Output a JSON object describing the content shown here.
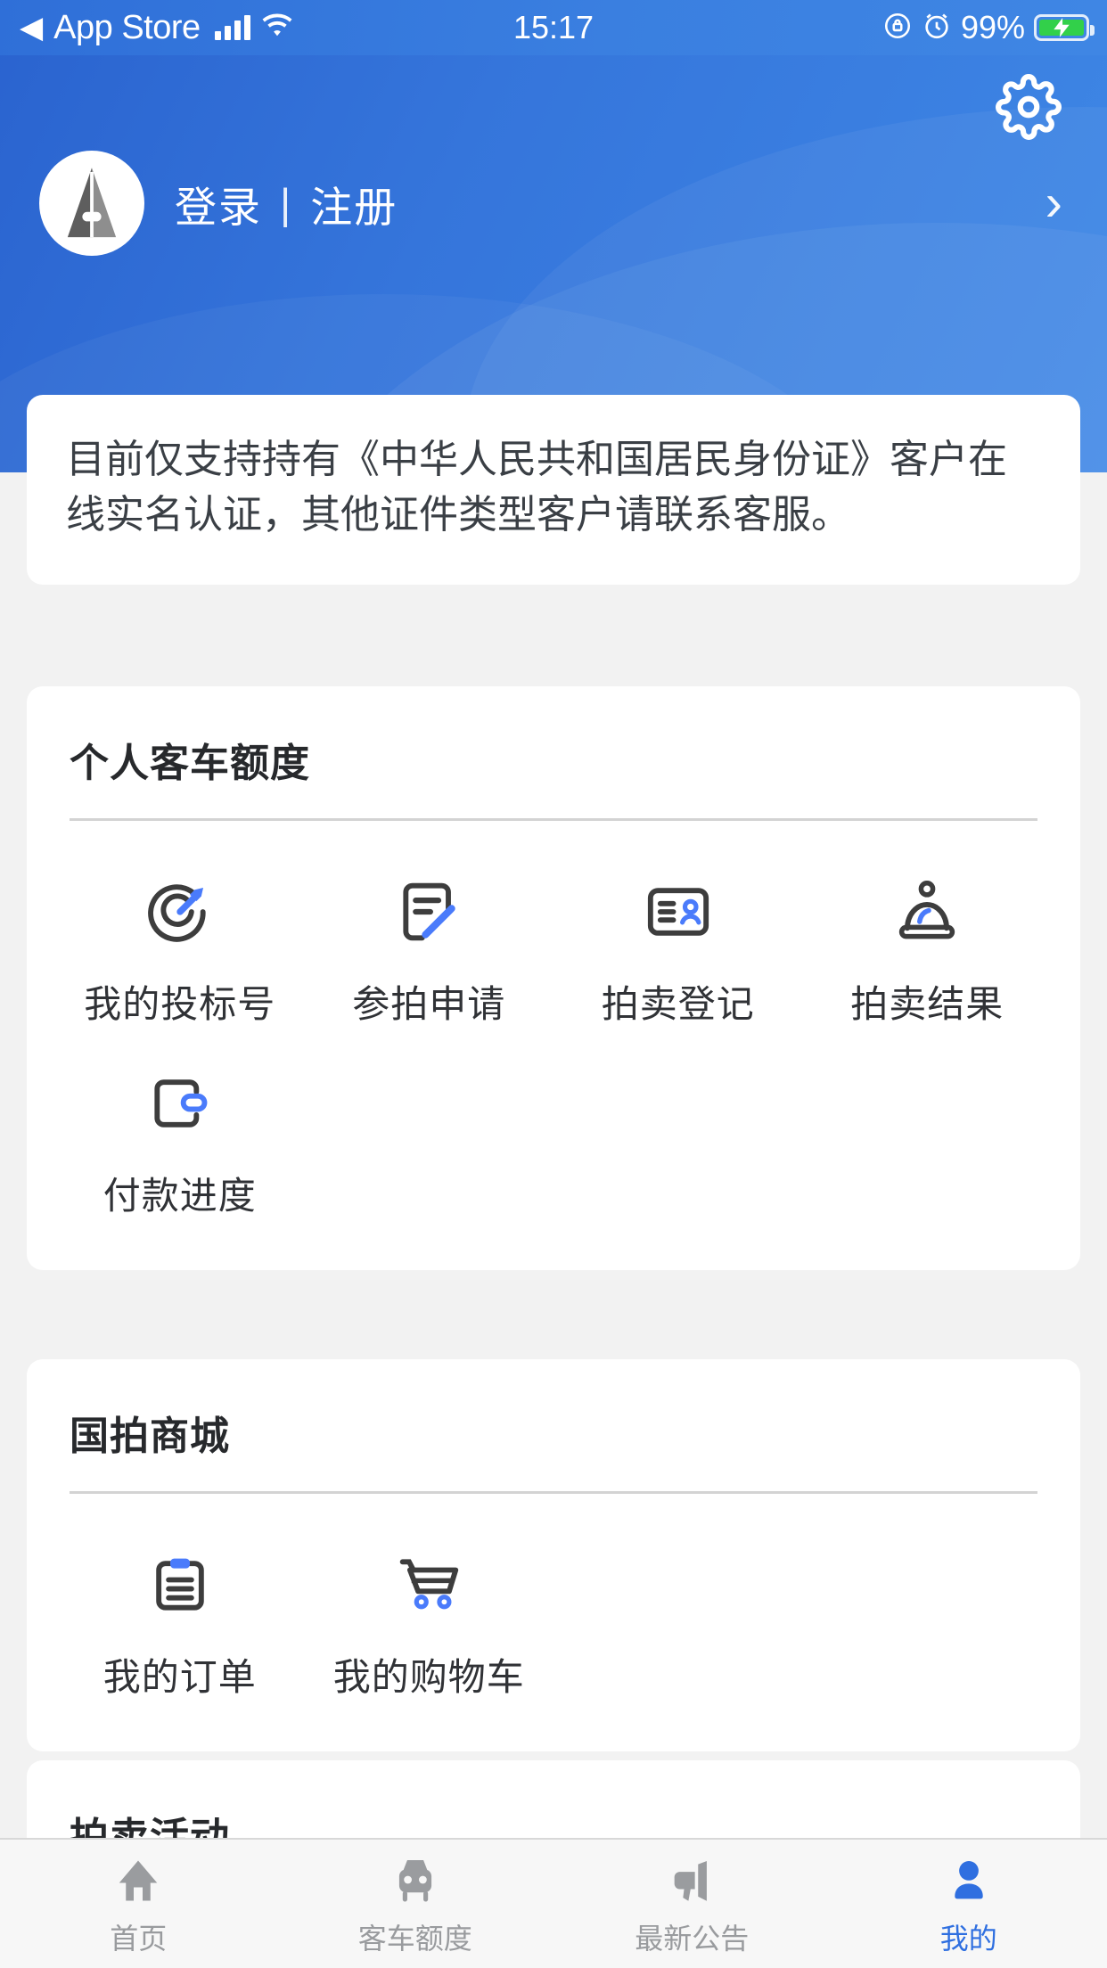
{
  "statusbar": {
    "back_label": "App Store",
    "back_icon": "triangle-left-icon",
    "signal_icon": "signal-bars-icon",
    "wifi_icon": "wifi-icon",
    "time": "15:17",
    "rotation_lock_icon": "rotation-lock-icon",
    "alarm_icon": "alarm-clock-icon",
    "battery_percent": "99%",
    "battery_icon": "battery-charging-icon"
  },
  "header": {
    "gear_icon": "gear-icon",
    "avatar_icon": "default-avatar-icon",
    "login_label": "登录",
    "separator": "|",
    "register_label": "注册",
    "chevron_icon": "chevron-right-icon",
    "gradient_start": "#2a63cf",
    "gradient_end": "#3f88e6"
  },
  "notice": {
    "text": "目前仅支持持有《中华人民共和国居民身份证》客户在线实名认证，其他证件类型客户请联系客服。"
  },
  "sections": [
    {
      "title": "个人客车额度",
      "items": [
        {
          "label": "我的投标号",
          "icon": "target-dart-icon"
        },
        {
          "label": "参拍申请",
          "icon": "document-pencil-icon"
        },
        {
          "label": "拍卖登记",
          "icon": "id-card-person-icon"
        },
        {
          "label": "拍卖结果",
          "icon": "auction-bell-icon"
        },
        {
          "label": "付款进度",
          "icon": "wallet-icon"
        }
      ]
    },
    {
      "title": "国拍商城",
      "items": [
        {
          "label": "我的订单",
          "icon": "clipboard-list-icon"
        },
        {
          "label": "我的购物车",
          "icon": "shopping-cart-icon"
        }
      ]
    },
    {
      "title": "拍卖活动",
      "items": []
    }
  ],
  "tabbar": {
    "items": [
      {
        "label": "首页",
        "icon": "home-icon",
        "active": false
      },
      {
        "label": "客车额度",
        "icon": "car-icon",
        "active": false
      },
      {
        "label": "最新公告",
        "icon": "megaphone-icon",
        "active": false
      },
      {
        "label": "我的",
        "icon": "person-icon",
        "active": true
      }
    ],
    "active_color": "#2f6fe0",
    "inactive_color": "#999b9e"
  },
  "colors": {
    "accent_blue": "#4a7bfb",
    "icon_dark": "#3d3d3d",
    "page_bg": "#f2f2f2"
  }
}
